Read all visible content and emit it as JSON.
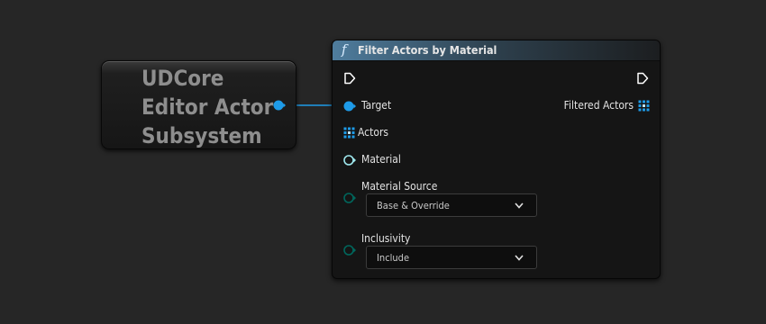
{
  "variable_node": {
    "title_lines": [
      "UDCore",
      "Editor Actor",
      "Subsystem"
    ],
    "output_pin_icon": "object-reference-pin-icon"
  },
  "function_node": {
    "title": "Filter Actors by Material",
    "title_icon": "function-icon",
    "function_glyph": "f",
    "header_color": "#4f7d9e",
    "inputs": {
      "exec_icon": "exec-in-pin-icon",
      "target": {
        "label": "Target",
        "icon": "object-reference-pin-icon",
        "color": "#1e9be8"
      },
      "actors": {
        "label": "Actors",
        "icon": "array-pin-icon",
        "color": "#1e9be8"
      },
      "material": {
        "label": "Material",
        "icon": "soft-object-pin-icon",
        "color": "#9fe8ee"
      },
      "material_source": {
        "label": "Material Source",
        "icon": "enum-pin-icon",
        "color": "#00665c",
        "value": "Base & Override"
      },
      "inclusivity": {
        "label": "Inclusivity",
        "icon": "enum-pin-icon",
        "color": "#00665c",
        "value": "Include"
      }
    },
    "outputs": {
      "exec_icon": "exec-out-pin-icon",
      "filtered_actors": {
        "label": "Filtered Actors",
        "icon": "array-pin-icon",
        "color": "#1e9be8"
      }
    }
  },
  "connection": {
    "from": "variable_node.output",
    "to": "function_node.target",
    "color": "#1e9be8"
  }
}
